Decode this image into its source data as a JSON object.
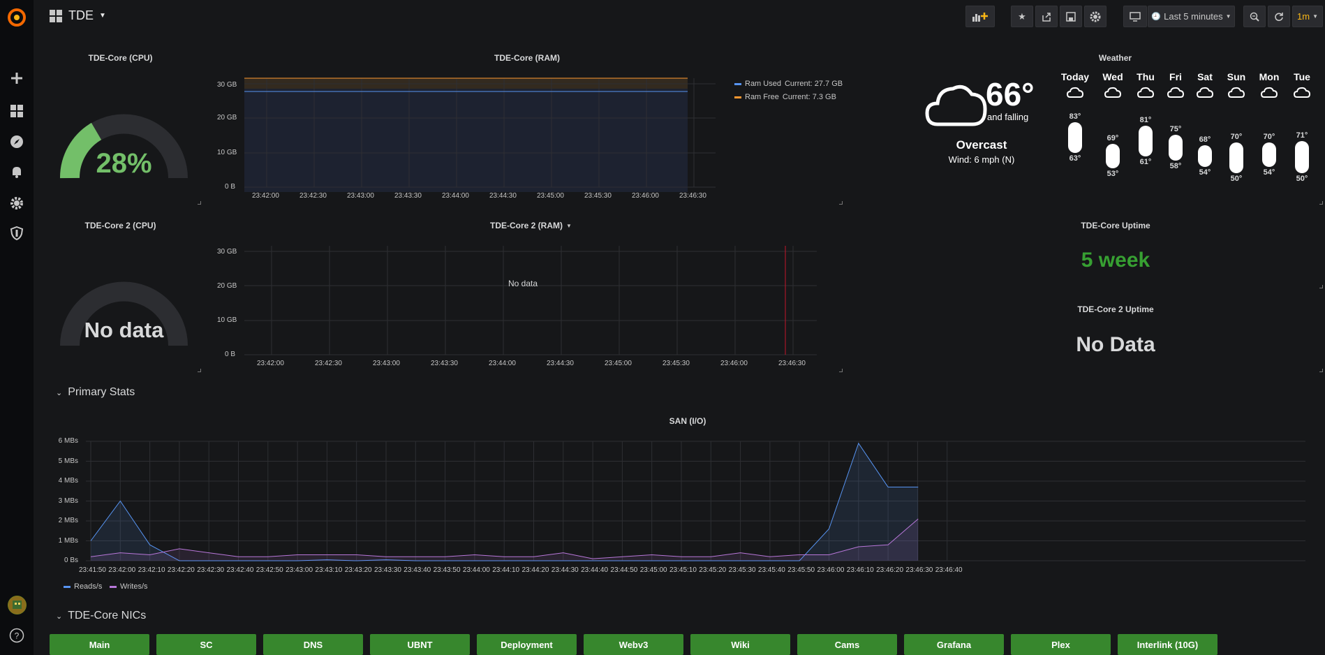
{
  "header": {
    "title": "TDE",
    "time_range": "Last 5 minutes",
    "refresh": "1m"
  },
  "colors": {
    "green": "#73bf69",
    "orange": "#ff9830",
    "red": "#f2495c",
    "blue": "#5794f2",
    "purple": "#b877d9",
    "nic_green": "#37872d"
  },
  "panels": {
    "cpu1": {
      "title": "TDE-Core (CPU)",
      "value": "28%",
      "percent": 28
    },
    "ram1": {
      "title": "TDE-Core (RAM)",
      "yticks": [
        "30 GB",
        "20 GB",
        "10 GB",
        "0 B"
      ],
      "xticks": [
        "23:42:00",
        "23:42:30",
        "23:43:00",
        "23:43:30",
        "23:44:00",
        "23:44:30",
        "23:45:00",
        "23:45:30",
        "23:46:00",
        "23:46:30"
      ],
      "legend": [
        {
          "label": "Ram Used",
          "current": "Current: 27.7 GB"
        },
        {
          "label": "Ram Free",
          "current": "Current: 7.3 GB"
        }
      ]
    },
    "weather": {
      "title": "Weather",
      "temp": "66°",
      "trend": "and falling",
      "condition": "Overcast",
      "wind": "Wind: 6 mph (N)",
      "forecast": [
        {
          "day": "Today",
          "high": "83°",
          "low": "63°"
        },
        {
          "day": "Wed",
          "high": "69°",
          "low": "53°"
        },
        {
          "day": "Thu",
          "high": "81°",
          "low": "61°"
        },
        {
          "day": "Fri",
          "high": "75°",
          "low": "58°"
        },
        {
          "day": "Sat",
          "high": "68°",
          "low": "54°"
        },
        {
          "day": "Sun",
          "high": "70°",
          "low": "50°"
        },
        {
          "day": "Mon",
          "high": "70°",
          "low": "54°"
        },
        {
          "day": "Tue",
          "high": "71°",
          "low": "50°"
        }
      ]
    },
    "cpu2": {
      "title": "TDE-Core 2 (CPU)",
      "value": "No data"
    },
    "ram2": {
      "title": "TDE-Core 2 (RAM)",
      "nodata": "No data",
      "yticks": [
        "30 GB",
        "20 GB",
        "10 GB",
        "0 B"
      ],
      "xticks": [
        "23:42:00",
        "23:42:30",
        "23:43:00",
        "23:43:30",
        "23:44:00",
        "23:44:30",
        "23:45:00",
        "23:45:30",
        "23:46:00",
        "23:46:30"
      ]
    },
    "uptime1": {
      "title": "TDE-Core Uptime",
      "value": "5 week"
    },
    "uptime2": {
      "title": "TDE-Core 2 Uptime",
      "value": "No Data"
    }
  },
  "rows": {
    "primary": "Primary Stats",
    "nics": "TDE-Core NICs"
  },
  "san": {
    "title": "SAN (I/O)",
    "yticks": [
      "6 MBs",
      "5 MBs",
      "4 MBs",
      "3 MBs",
      "2 MBs",
      "1 MBs",
      "0 Bs"
    ],
    "xticks": [
      "23:41:50",
      "23:42:00",
      "23:42:10",
      "23:42:20",
      "23:42:30",
      "23:42:40",
      "23:42:50",
      "23:43:00",
      "23:43:10",
      "23:43:20",
      "23:43:30",
      "23:43:40",
      "23:43:50",
      "23:44:00",
      "23:44:10",
      "23:44:20",
      "23:44:30",
      "23:44:40",
      "23:44:50",
      "23:45:00",
      "23:45:10",
      "23:45:20",
      "23:45:30",
      "23:45:40",
      "23:45:50",
      "23:46:00",
      "23:46:10",
      "23:46:20",
      "23:46:30",
      "23:46:40"
    ],
    "legend": [
      "Reads/s",
      "Writes/s"
    ]
  },
  "chart_data": [
    {
      "type": "line",
      "title": "SAN (I/O)",
      "ylabel": "",
      "ylim": [
        0,
        6
      ],
      "x": [
        "23:41:50",
        "23:42:00",
        "23:42:10",
        "23:42:20",
        "23:42:30",
        "23:42:40",
        "23:42:50",
        "23:43:00",
        "23:43:10",
        "23:43:20",
        "23:43:30",
        "23:43:40",
        "23:43:50",
        "23:44:00",
        "23:44:10",
        "23:44:20",
        "23:44:30",
        "23:44:40",
        "23:44:50",
        "23:45:00",
        "23:45:10",
        "23:45:20",
        "23:45:30",
        "23:45:40",
        "23:45:50",
        "23:46:00",
        "23:46:10",
        "23:46:20",
        "23:46:25"
      ],
      "series": [
        {
          "name": "Reads/s",
          "values": [
            1.0,
            3.0,
            0.8,
            0.0,
            0.0,
            0.0,
            0.0,
            0.0,
            0.05,
            0.0,
            0.05,
            0.0,
            0.0,
            0.0,
            0.0,
            0.0,
            0.0,
            0.0,
            0.0,
            0.0,
            0.0,
            0.0,
            0.0,
            0.0,
            0.0,
            1.6,
            5.9,
            3.7,
            3.7
          ]
        },
        {
          "name": "Writes/s",
          "values": [
            0.2,
            0.4,
            0.3,
            0.6,
            0.4,
            0.2,
            0.2,
            0.3,
            0.3,
            0.3,
            0.2,
            0.2,
            0.2,
            0.3,
            0.2,
            0.2,
            0.4,
            0.1,
            0.2,
            0.3,
            0.2,
            0.2,
            0.4,
            0.2,
            0.3,
            0.3,
            0.7,
            0.8,
            2.1
          ]
        }
      ]
    },
    {
      "type": "line",
      "title": "TDE-Core (RAM)",
      "ylim": [
        0,
        30
      ],
      "series": [
        {
          "name": "Ram Used",
          "values": [
            27.7
          ]
        },
        {
          "name": "Ram Free",
          "values": [
            7.3
          ]
        }
      ]
    }
  ],
  "nics": [
    "Main",
    "SC",
    "DNS",
    "UBNT",
    "Deployment",
    "Webv3",
    "Wiki",
    "Cams",
    "Grafana",
    "Plex",
    "Interlink (10G)"
  ]
}
